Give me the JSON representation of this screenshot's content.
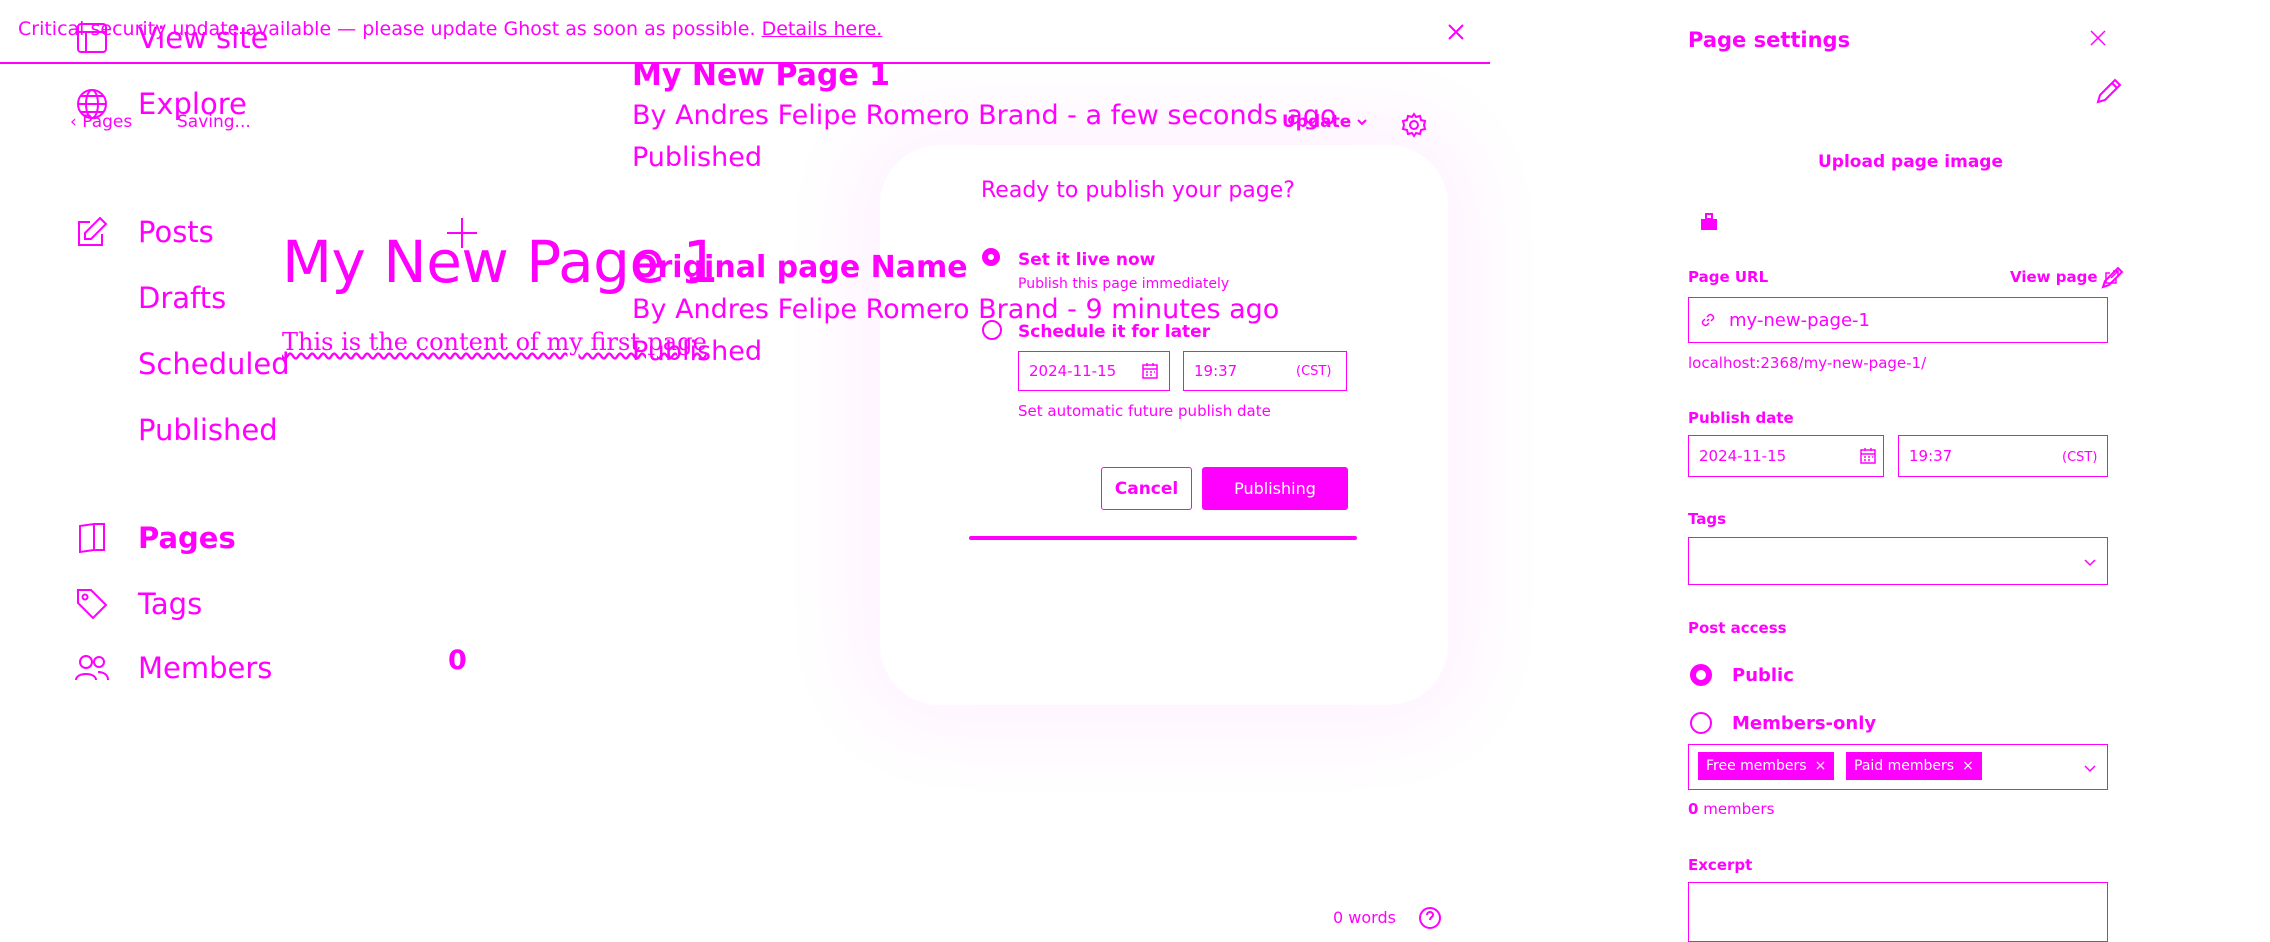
{
  "theme": {
    "accent": "#ff00ff",
    "background": "#ffffff"
  },
  "banner": {
    "text": "Critical security update available — please update Ghost as soon as possible.",
    "link": "Details here."
  },
  "sidebar": {
    "items": [
      {
        "label": "View site",
        "icon": "layout-icon"
      },
      {
        "label": "Explore",
        "icon": "globe-icon"
      },
      {
        "label": "Posts",
        "icon": "edit-icon"
      },
      {
        "label": "Drafts"
      },
      {
        "label": "Scheduled"
      },
      {
        "label": "Published"
      },
      {
        "label": "Pages",
        "icon": "page-icon"
      },
      {
        "label": "Tags",
        "icon": "tag-icon"
      },
      {
        "label": "Members",
        "icon": "members-icon",
        "count": "0"
      }
    ]
  },
  "editor": {
    "breadcrumb": "Pages",
    "status": "Saving...",
    "title": "My New Page 1",
    "content": "This is the content of my first page",
    "update_label": "Update",
    "word_count": "0 words"
  },
  "page_list": [
    {
      "title": "My New Page 1",
      "meta": "By Andres Felipe Romero Brand - a few seconds ago",
      "status": "Published"
    },
    {
      "title": "Original page Name",
      "meta": "By Andres Felipe Romero Brand - 9 minutes ago",
      "status": "Published"
    }
  ],
  "publish_modal": {
    "title": "Ready to publish your page?",
    "option_now": {
      "label": "Set it live now",
      "hint": "Publish this page immediately",
      "selected": true
    },
    "option_later": {
      "label": "Schedule it for later",
      "selected": false
    },
    "date": "2024-11-15",
    "time": "19:37",
    "timezone": "(CST)",
    "schedule_hint": "Set automatic future publish date",
    "cancel_label": "Cancel",
    "publish_label": "Publishing"
  },
  "settings": {
    "title": "Page settings",
    "upload_label": "Upload page image",
    "url_label": "Page URL",
    "view_page_label": "View page",
    "url_value": "my-new-page-1",
    "url_full": "localhost:2368/my-new-page-1/",
    "publish_date_label": "Publish date",
    "date": "2024-11-15",
    "time": "19:37",
    "timezone": "(CST)",
    "tags_label": "Tags",
    "access_label": "Post access",
    "access_options": [
      {
        "label": "Public",
        "selected": true
      },
      {
        "label": "Members-only",
        "selected": false
      }
    ],
    "segments": [
      "Free members",
      "Paid members"
    ],
    "member_count": "0",
    "member_count_suffix": " members",
    "excerpt_label": "Excerpt"
  }
}
